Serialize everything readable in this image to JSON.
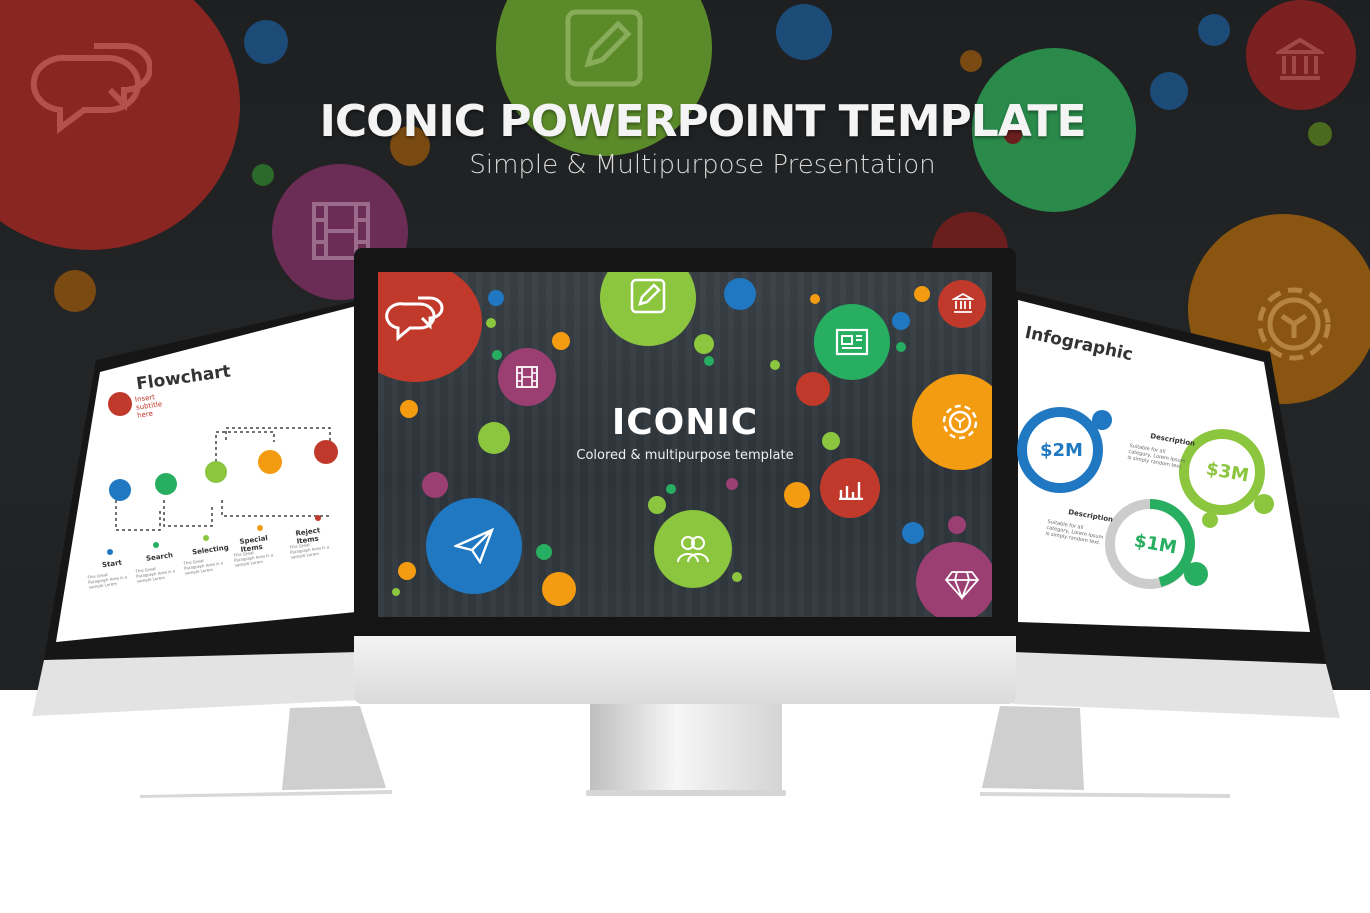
{
  "hero": {
    "title": "ICONIC POWERPOINT TEMPLATE",
    "subtitle": "Simple & Multipurpose Presentation"
  },
  "center_slide": {
    "title": "ICONIC",
    "subtitle": "Colored & multipurpose template",
    "icons": [
      "chat-icon",
      "edit-icon",
      "bank-icon",
      "news-icon",
      "film-icon",
      "gear-icon",
      "chart-icon",
      "send-icon",
      "users-icon",
      "diamond-icon"
    ]
  },
  "left_slide": {
    "title": "Flowchart",
    "subtitle": "Insert subtitle here",
    "steps": [
      {
        "label": "Start",
        "text": "This Great Paragraph Area is a sample Lorem"
      },
      {
        "label": "Search",
        "text": "This Great Paragraph Area is a sample Lorem"
      },
      {
        "label": "Selecting",
        "text": "This Great Paragraph Area is a sample Lorem"
      },
      {
        "label": "Special Items",
        "text": "This Great Paragraph Area is a sample Lorem"
      },
      {
        "label": "Reject Items",
        "text": "This Great Paragraph Area is a sample Lorem"
      }
    ]
  },
  "right_slide": {
    "title": "Infographic",
    "values": [
      "$2M",
      "$3M",
      "$1M"
    ],
    "desc_title": "Description",
    "desc_text": "Suitable for all category, Lorem Ipsum is simply random text."
  },
  "colors": {
    "red": "#c0392b",
    "green": "#8cc63f",
    "blue": "#1f78c1",
    "teal": "#27ae60",
    "orange": "#f39c12",
    "purple": "#8e44ad",
    "magenta": "#9b3f73"
  }
}
